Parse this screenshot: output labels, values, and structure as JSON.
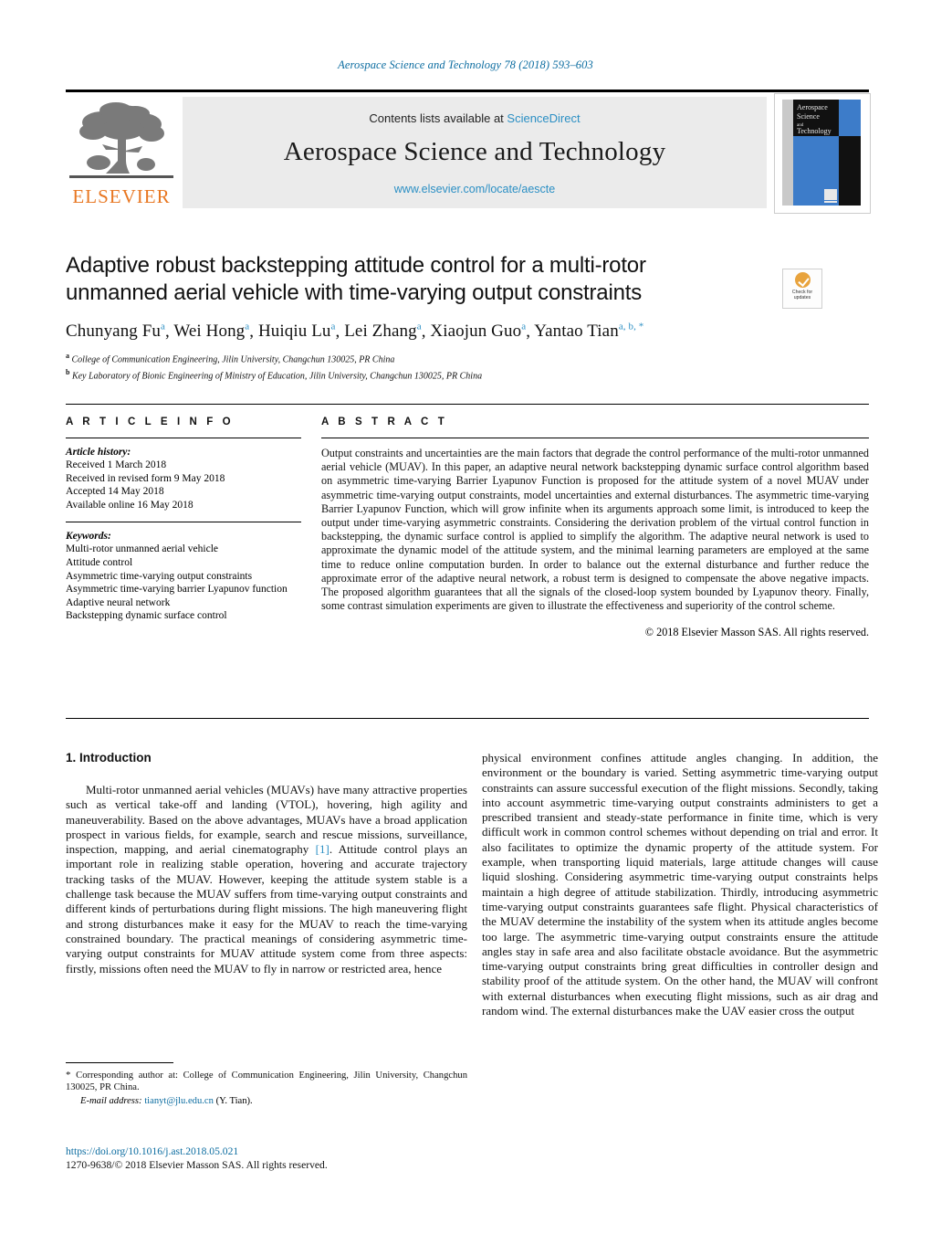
{
  "running_head": "Aerospace Science and Technology 78 (2018) 593–603",
  "masthead": {
    "contents_prefix": "Contents lists available at ",
    "sciencedirect": "ScienceDirect",
    "journal_title": "Aerospace Science and Technology",
    "journal_url": "www.elsevier.com/locate/aescte",
    "publisher_wordmark": "ELSEVIER",
    "cover": {
      "line1": "Aerospace",
      "line2": "Science",
      "line3": "and",
      "line4": "Technology"
    }
  },
  "article": {
    "title": "Adaptive robust backstepping attitude control for a multi-rotor unmanned aerial vehicle with time-varying output constraints",
    "authors": [
      {
        "name": "Chunyang Fu",
        "marks": "a"
      },
      {
        "name": "Wei Hong",
        "marks": "a"
      },
      {
        "name": "Huiqiu Lu",
        "marks": "a"
      },
      {
        "name": "Lei Zhang",
        "marks": "a"
      },
      {
        "name": "Xiaojun Guo",
        "marks": "a"
      },
      {
        "name": "Yantao Tian",
        "marks": "a, b, *"
      }
    ],
    "affiliations": [
      {
        "mark": "a",
        "text": "College of Communication Engineering, Jilin University, Changchun 130025, PR China"
      },
      {
        "mark": "b",
        "text": "Key Laboratory of Bionic Engineering of Ministry of Education, Jilin University, Changchun 130025, PR China"
      }
    ],
    "crossmark": {
      "line1": "Check for",
      "line2": "updates"
    }
  },
  "article_info": {
    "heading": "A R T I C L E   I N F O",
    "history_label": "Article history:",
    "history": [
      "Received 1 March 2018",
      "Received in revised form 9 May 2018",
      "Accepted 14 May 2018",
      "Available online 16 May 2018"
    ],
    "keywords_label": "Keywords:",
    "keywords": [
      "Multi-rotor unmanned aerial vehicle",
      "Attitude control",
      "Asymmetric time-varying output constraints",
      "Asymmetric time-varying barrier Lyapunov function",
      "Adaptive neural network",
      "Backstepping dynamic surface control"
    ]
  },
  "abstract": {
    "heading": "A B S T R A C T",
    "text": "Output constraints and uncertainties are the main factors that degrade the control performance of the multi-rotor unmanned aerial vehicle (MUAV). In this paper, an adaptive neural network backstepping dynamic surface control algorithm based on asymmetric time-varying Barrier Lyapunov Function is proposed for the attitude system of a novel MUAV under asymmetric time-varying output constraints, model uncertainties and external disturbances. The asymmetric time-varying Barrier Lyapunov Function, which will grow infinite when its arguments approach some limit, is introduced to keep the output under time-varying asymmetric constraints. Considering the derivation problem of the virtual control function in backstepping, the dynamic surface control is applied to simplify the algorithm. The adaptive neural network is used to approximate the dynamic model of the attitude system, and the minimal learning parameters are employed at the same time to reduce online computation burden. In order to balance out the external disturbance and further reduce the approximate error of the adaptive neural network, a robust term is designed to compensate the above negative impacts. The proposed algorithm guarantees that all the signals of the closed-loop system bounded by Lyapunov theory. Finally, some contrast simulation experiments are given to illustrate the effectiveness and superiority of the control scheme.",
    "copyright": "© 2018 Elsevier Masson SAS. All rights reserved."
  },
  "body": {
    "section_heading": "1. Introduction",
    "left_para_1_a": "Multi-rotor unmanned aerial vehicles (MUAVs) have many attractive properties such as vertical take-off and landing (VTOL), hovering, high agility and maneuverability. Based on the above advantages, MUAVs have a broad application prospect in various fields, for example, search and rescue missions, surveillance, inspection, mapping, and aerial cinematography ",
    "left_para_1_ref": "[1]",
    "left_para_1_b": ". Attitude control plays an important role in realizing stable operation, hovering and accurate trajectory tracking tasks of the MUAV. However, keeping the attitude system stable is a challenge task because the MUAV suffers from time-varying output constraints and different kinds of perturbations during flight missions. The high maneuvering flight and strong disturbances make it easy for the MUAV to reach the time-varying constrained boundary. The practical meanings of considering asymmetric time-varying output constraints for MUAV attitude system come from three aspects: firstly, missions often need the MUAV to fly in narrow or restricted area, hence",
    "right_para": "physical environment confines attitude angles changing. In addition, the environment or the boundary is varied. Setting asymmetric time-varying output constraints can assure successful execution of the flight missions. Secondly, taking into account asymmetric time-varying output constraints administers to get a prescribed transient and steady-state performance in finite time, which is very difficult work in common control schemes without depending on trial and error. It also facilitates to optimize the dynamic property of the attitude system. For example, when transporting liquid materials, large attitude changes will cause liquid sloshing. Considering asymmetric time-varying output constraints helps maintain a high degree of attitude stabilization. Thirdly, introducing asymmetric time-varying output constraints guarantees safe flight. Physical characteristics of the MUAV determine the instability of the system when its attitude angles become too large. The asymmetric time-varying output constraints ensure the attitude angles stay in safe area and also facilitate obstacle avoidance. But the asymmetric time-varying output constraints bring great difficulties in controller design and stability proof of the attitude system. On the other hand, the MUAV will confront with external disturbances when executing flight missions, such as air drag and random wind. The external disturbances make the UAV easier cross the output"
  },
  "footnotes": {
    "corresponding_mark": "*",
    "corresponding_text": "Corresponding author at: College of Communication Engineering, Jilin University, Changchun 130025, PR China.",
    "email_label": "E-mail address:",
    "email_address": "tianyt@jlu.edu.cn",
    "email_owner": "(Y. Tian).",
    "doi": "https://doi.org/10.1016/j.ast.2018.05.021",
    "issn_line": "1270-9638/© 2018 Elsevier Masson SAS. All rights reserved."
  },
  "colors": {
    "link": "#2b8fc4",
    "running_head": "#0b6ca0",
    "elsevier_orange": "#E87722",
    "cover_blue": "#3d7cc9",
    "band_gray": "#ebebeb"
  }
}
